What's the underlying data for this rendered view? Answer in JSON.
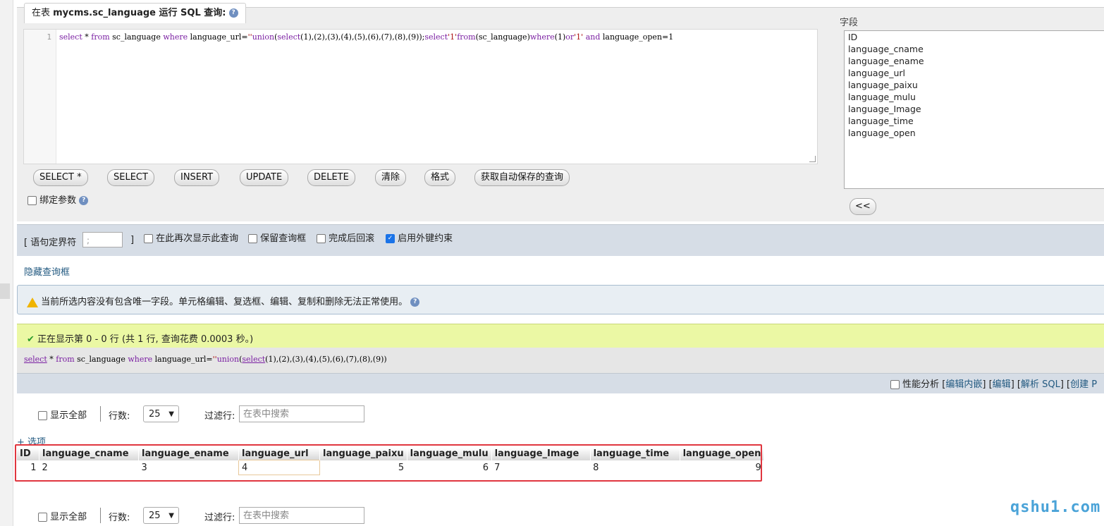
{
  "query_panel": {
    "title_prefix": "在表 ",
    "table_name": "mycms.sc_language",
    "title_suffix": " 运行 SQL 查询:",
    "line_number": "1",
    "sql_tokens": [
      {
        "t": "select",
        "k": "kw"
      },
      {
        "t": " * "
      },
      {
        "t": "from",
        "k": "kw"
      },
      {
        "t": " sc_language "
      },
      {
        "t": "where",
        "k": "kw"
      },
      {
        "t": " language_url="
      },
      {
        "t": "''",
        "k": "str"
      },
      {
        "t": "union",
        "k": "kw"
      },
      {
        "t": "("
      },
      {
        "t": "select",
        "k": "kw"
      },
      {
        "t": "(1),(2),(3),(4),(5),(6),(7),(8),(9));"
      },
      {
        "t": "select",
        "k": "kw"
      },
      {
        "t": "'1'",
        "k": "str"
      },
      {
        "t": "from",
        "k": "kw"
      },
      {
        "t": "(sc_language)"
      },
      {
        "t": "where",
        "k": "kw"
      },
      {
        "t": "(1)"
      },
      {
        "t": "or",
        "k": "kw"
      },
      {
        "t": "'1'",
        "k": "str"
      },
      {
        "t": "  "
      },
      {
        "t": "and",
        "k": "kw"
      },
      {
        "t": "  language_open=1"
      }
    ],
    "buttons": [
      "SELECT *",
      "SELECT",
      "INSERT",
      "UPDATE",
      "DELETE",
      "清除",
      "格式",
      "获取自动保存的查询"
    ],
    "bind_params_label": "绑定参数",
    "fields_label": "字段",
    "fields": [
      "ID",
      "language_cname",
      "language_ename",
      "language_url",
      "language_paixu",
      "language_mulu",
      "language_Image",
      "language_time",
      "language_open"
    ],
    "insert_button": "<<"
  },
  "options": {
    "delimiter_open": "[ 语句定界符",
    "delimiter_value": ";",
    "delimiter_close": "]",
    "show_again_label": "在此再次显示此查询",
    "retain_box_label": "保留查询框",
    "rollback_label": "完成后回滚",
    "fk_label": "启用外键约束",
    "fk_checked": true,
    "hide_link": "隐藏查询框"
  },
  "notice": {
    "text": "当前所选内容没有包含唯一字段。单元格编辑、复选框、编辑、复制和删除无法正常使用。"
  },
  "success": {
    "text": "正在显示第 0 - 0 行 (共 1 行, 查询花费 0.0003 秒。)"
  },
  "executed_sql": {
    "tokens": [
      {
        "t": "select",
        "k": "kwu"
      },
      {
        "t": " * "
      },
      {
        "t": "from",
        "k": "kw"
      },
      {
        "t": " sc_language "
      },
      {
        "t": "where",
        "k": "kw"
      },
      {
        "t": " language_url="
      },
      {
        "t": "''",
        "k": "str"
      },
      {
        "t": "union",
        "k": "kw"
      },
      {
        "t": "("
      },
      {
        "t": "select",
        "k": "kwu"
      },
      {
        "t": "(1),(2),(3),(4),(5),(6),(7),(8),(9))"
      }
    ]
  },
  "profiling": {
    "label": "性能分析",
    "links": [
      "[",
      "编辑内嵌",
      "] [",
      "编辑",
      "] [",
      "解析 SQL",
      "] [",
      "创建 P"
    ]
  },
  "nav": {
    "show_all": "显示全部",
    "rows_label": "行数:",
    "rows_value": "25",
    "filter_label": "过滤行:",
    "filter_placeholder": "在表中搜索"
  },
  "options_link": "+ 选项",
  "result": {
    "headers": [
      "ID",
      "language_cname",
      "language_ename",
      "language_url",
      "language_paixu",
      "language_mulu",
      "language_Image",
      "language_time",
      "language_open"
    ],
    "row": [
      "1",
      "2",
      "3",
      "4",
      "5",
      "6",
      "7",
      "8",
      "9"
    ]
  },
  "watermark": "qshu1.com"
}
